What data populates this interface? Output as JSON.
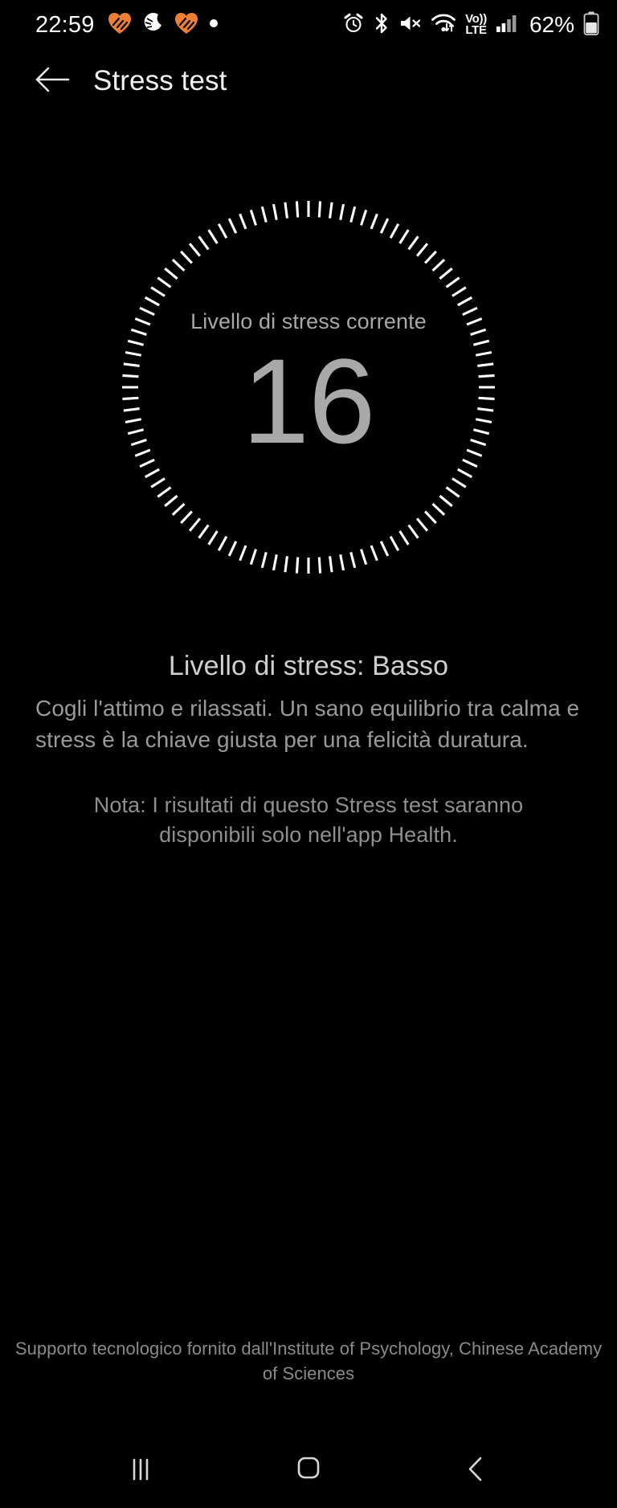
{
  "status_bar": {
    "time": "22:59",
    "battery_percent": "62%",
    "notification_icons": [
      "heart-orange-icon",
      "sleep-moon-icon",
      "heart-orange-icon",
      "dot-icon"
    ],
    "system_icons": [
      "alarm-icon",
      "bluetooth-icon",
      "mute-icon",
      "wifi-icon",
      "volte-icon",
      "signal-icon",
      "battery-icon"
    ],
    "volte_top": "Vo))",
    "volte_bottom": "LTE"
  },
  "app_bar": {
    "back_icon": "back-arrow-icon",
    "title": "Stress test"
  },
  "gauge": {
    "label": "Livello di stress corrente",
    "value": "16",
    "tick_count": 100,
    "tick_color": "#ffffff",
    "value_color": "#a9a9a9"
  },
  "info": {
    "level_heading": "Livello di stress: Basso",
    "description": "Cogli l'attimo e rilassati. Un sano equilibrio tra calma e stress è la chiave giusta per una felicità duratura.",
    "note": "Nota: I risultati di questo Stress test saranno disponibili solo nell'app Health."
  },
  "footer": {
    "credit": "Supporto tecnologico fornito dall'Institute of Psychology, Chinese Academy of Sciences"
  },
  "nav_bar": {
    "recents_icon": "recents-icon",
    "home_icon": "home-icon",
    "back_icon": "nav-back-icon"
  },
  "colors": {
    "background": "#000000",
    "accent_orange": "#ec7f35",
    "text_primary": "#ffffff",
    "text_secondary": "#9a9a9a"
  }
}
